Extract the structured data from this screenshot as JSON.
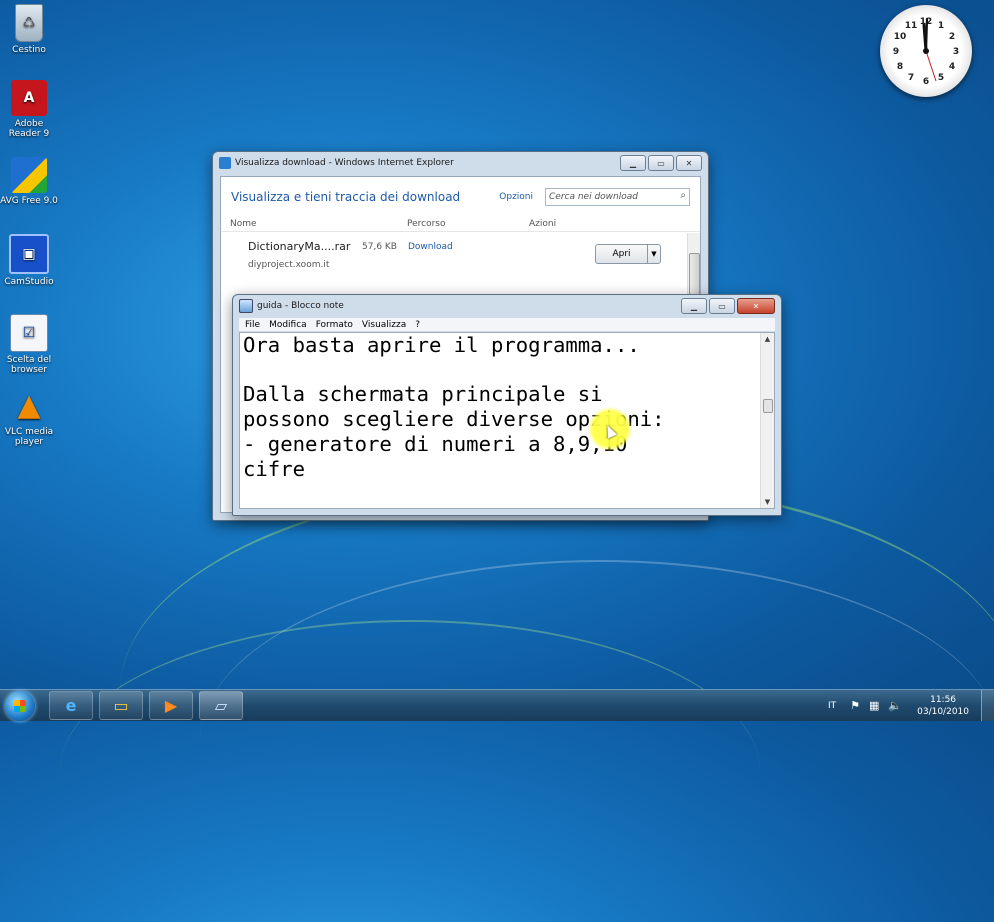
{
  "desktop": {
    "icons": [
      {
        "label": "Cestino",
        "icon": "recycle-bin-icon"
      },
      {
        "label": "Adobe Reader 9",
        "icon": "adobe-reader-icon"
      },
      {
        "label": "AVG Free 9.0",
        "icon": "avg-icon"
      },
      {
        "label": "CamStudio",
        "icon": "camstudio-icon"
      },
      {
        "label": "Scelta del browser",
        "icon": "browser-choice-icon"
      },
      {
        "label": "VLC media player",
        "icon": "vlc-icon"
      }
    ]
  },
  "clock_gadget": {
    "numerals": [
      "12",
      "1",
      "2",
      "3",
      "4",
      "5",
      "6",
      "7",
      "8",
      "9",
      "10",
      "11"
    ]
  },
  "ie_window": {
    "title": "Visualizza download - Windows Internet Explorer",
    "heading": "Visualizza e tieni traccia dei download",
    "options_link": "Opzioni",
    "search_placeholder": "Cerca nei download",
    "columns": {
      "name": "Nome",
      "path": "Percorso",
      "actions": "Azioni"
    },
    "download": {
      "name": "DictionaryMa....rar",
      "host": "diyproject.xoom.it",
      "size": "57,6 KB",
      "location": "Download",
      "button": "Apri"
    }
  },
  "notepad": {
    "title": "guida - Blocco note",
    "menu": [
      "File",
      "Modifica",
      "Formato",
      "Visualizza",
      "?"
    ],
    "lines": [
      "Ora basta aprire il programma...",
      "",
      "Dalla schermata principale si",
      "possono scegliere diverse opzioni:",
      "- generatore di numeri a 8,9,10",
      "cifre"
    ]
  },
  "taskbar": {
    "language": "IT",
    "time": "11:56",
    "date": "03/10/2010"
  }
}
